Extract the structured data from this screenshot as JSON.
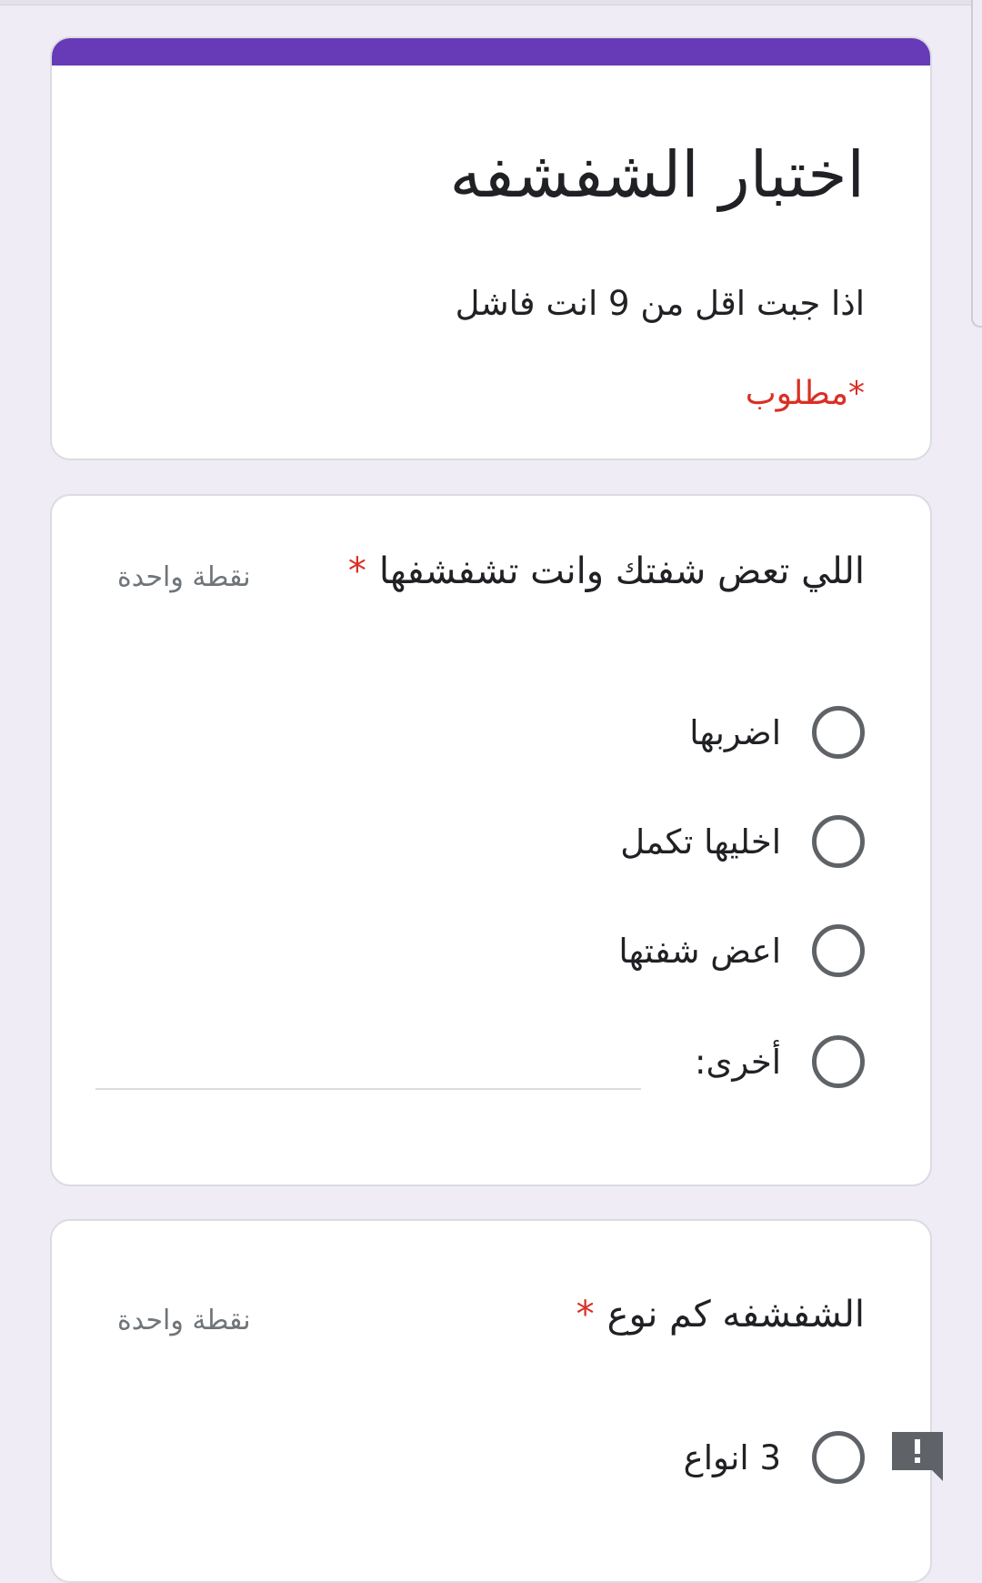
{
  "form": {
    "title": "اختبار الشفشفه",
    "description": "اذا جبت اقل من 9 انت فاشل",
    "required_note": "*مطلوب"
  },
  "questions": [
    {
      "title": "اللي تعض شفتك وانت تشفشفها",
      "required_mark": "*",
      "points": "نقطة واحدة",
      "options": [
        "اضربها",
        "اخليها تكمل",
        "اعض شفتها"
      ],
      "other_label": "أخرى:",
      "other_value": ""
    },
    {
      "title": "الشفشفه كم نوع",
      "required_mark": "*",
      "points": "نقطة واحدة",
      "options": [
        "3 انواع"
      ]
    }
  ],
  "colors": {
    "accent": "#673ab7",
    "background": "#efecf6",
    "required": "#d93025"
  },
  "icons": {
    "feedback": "report-feedback-icon"
  }
}
